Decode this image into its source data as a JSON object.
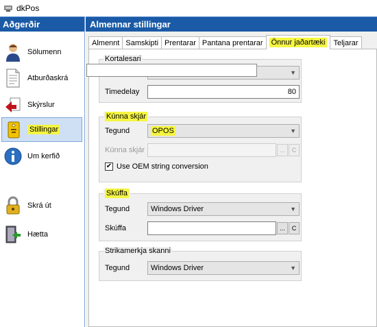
{
  "window": {
    "title": "dkPos"
  },
  "sidebar": {
    "header": "Aðgerðir",
    "items": [
      {
        "label": "Sölumenn",
        "icon": "person-icon"
      },
      {
        "label": "Atburðaskrá",
        "icon": "document-icon"
      },
      {
        "label": "Skýrslur",
        "icon": "arrow-back-icon"
      },
      {
        "label": "Stillingar",
        "icon": "settings-tag-icon"
      },
      {
        "label": "Um kerfið",
        "icon": "info-icon"
      },
      {
        "label": "Skrá út",
        "icon": "lock-icon"
      },
      {
        "label": "Hætta",
        "icon": "exit-door-icon"
      }
    ]
  },
  "main": {
    "header": "Almennar stillingar",
    "tabs": [
      "Almennt",
      "Samskipti",
      "Prentarar",
      "Pantana prentarar",
      "Önnur jaðartæki",
      "Teljarar"
    ],
    "active_tab": "Önnur jaðartæki"
  },
  "kortalesari": {
    "title": "Kortalesari",
    "timedelay_label": "Timedelay",
    "timedelay_value": "80"
  },
  "kunna_skjar": {
    "title": "Kúnna skjár",
    "tegund_label": "Tegund",
    "tegund_value": "OPOS",
    "kunna_label": "Kúnna skjár",
    "kunna_value": "",
    "oem_label": "Use OEM string conversion",
    "oem_checked": true
  },
  "skuffa": {
    "title": "Skúffa",
    "tegund_label": "Tegund",
    "tegund_value": "Windows Driver",
    "skuffa_label": "Skúffa",
    "skuffa_value": ""
  },
  "strikamerkja": {
    "title": "Strikamerkja skanni",
    "tegund_label": "Tegund",
    "tegund_value": "Windows Driver"
  },
  "buttons": {
    "browse": "...",
    "clear": "C"
  },
  "colors": {
    "header_blue": "#1a5aa6",
    "highlight": "#f5f542"
  }
}
